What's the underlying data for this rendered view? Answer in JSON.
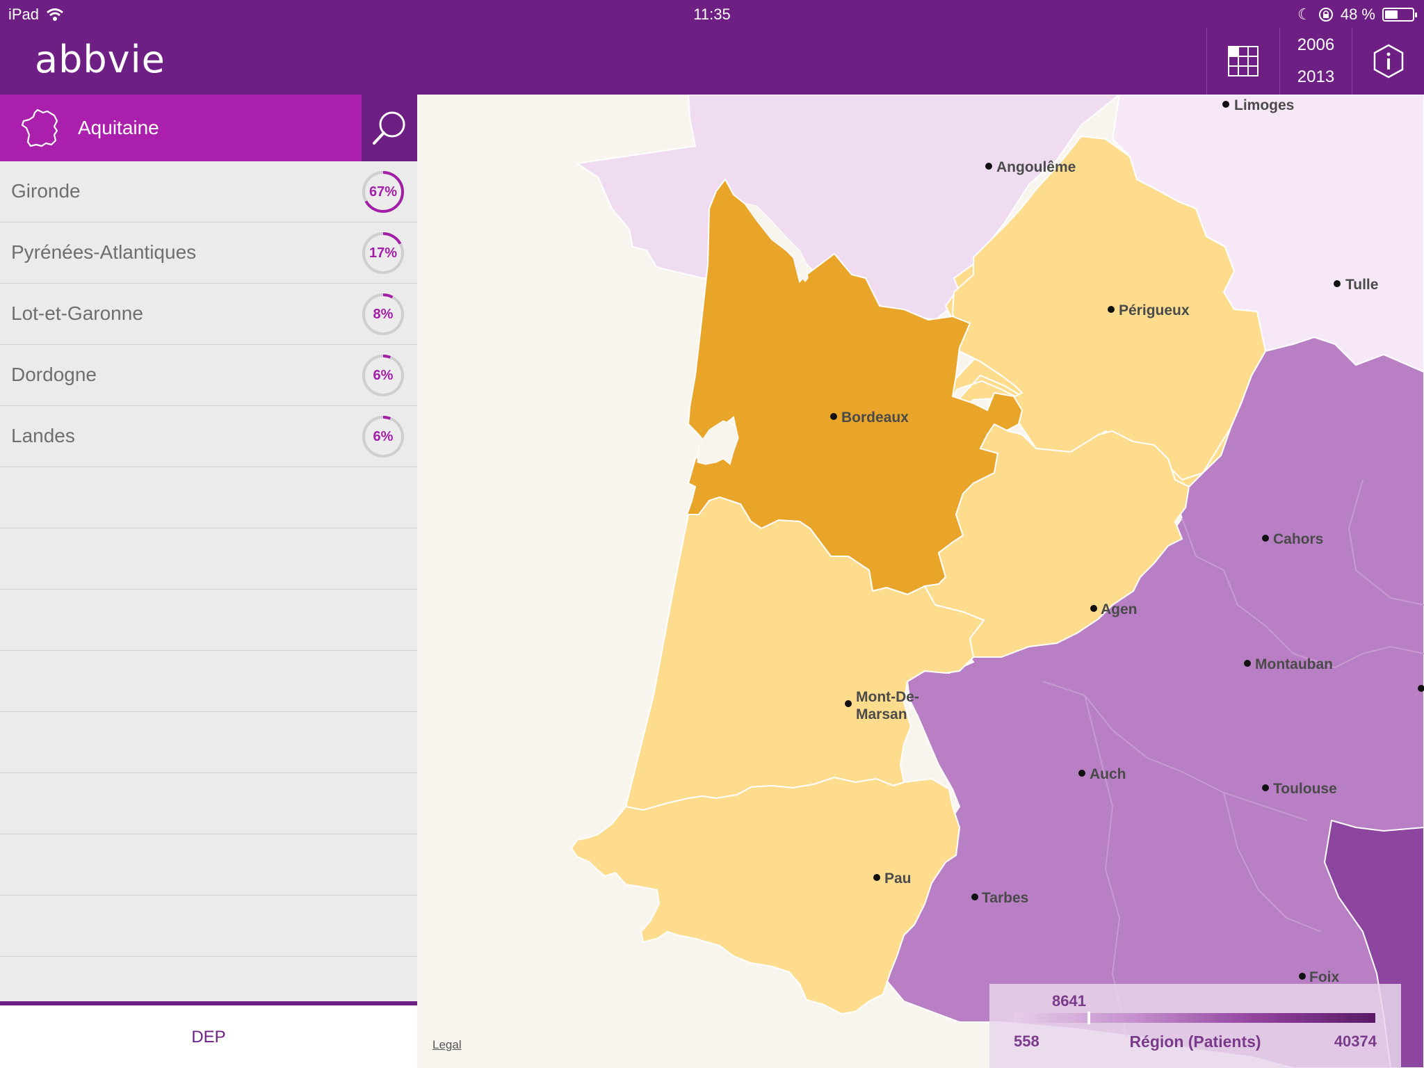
{
  "status_bar": {
    "device": "iPad",
    "time": "11:35",
    "battery": "48 %",
    "battery_level": 0.48
  },
  "header": {
    "logo": "abbvie",
    "year_start": "2006",
    "year_end": "2013",
    "grid_icon": "grid-icon",
    "info_icon": "info-icon"
  },
  "sidebar": {
    "region": "Aquitaine",
    "rows": [
      {
        "name": "Gironde",
        "percent": "67%",
        "value": 0.67
      },
      {
        "name": "Pyrénées-Atlantiques",
        "percent": "17%",
        "value": 0.17
      },
      {
        "name": "Lot-et-Garonne",
        "percent": "8%",
        "value": 0.08
      },
      {
        "name": "Dordogne",
        "percent": "6%",
        "value": 0.06
      },
      {
        "name": "Landes",
        "percent": "6%",
        "value": 0.06
      }
    ],
    "empty_rows": 9,
    "footer": "DEP"
  },
  "map": {
    "cities": [
      "Limoges",
      "Angoulême",
      "Tulle",
      "Périgueux",
      "Bordeaux",
      "Cahors",
      "Agen",
      "Montauban",
      "Mont-De-",
      "Marsan",
      "Auch",
      "Toulouse",
      "Pau",
      "Tarbes",
      "Foix"
    ],
    "legal": "Legal",
    "colors": {
      "gironde": "#e8a52a",
      "aquitaine_other": "#fddc8e",
      "midi_pyrenees": "#b97fc4",
      "dark_purple": "#8d46a0",
      "limousin": "#f7e8f8",
      "poitou": "#efdcf1",
      "sea": "#f8f4ee"
    },
    "legend": {
      "min": "558",
      "max": "40374",
      "current": "8641",
      "current_value": 8641,
      "label": "Région (Patients)"
    }
  }
}
